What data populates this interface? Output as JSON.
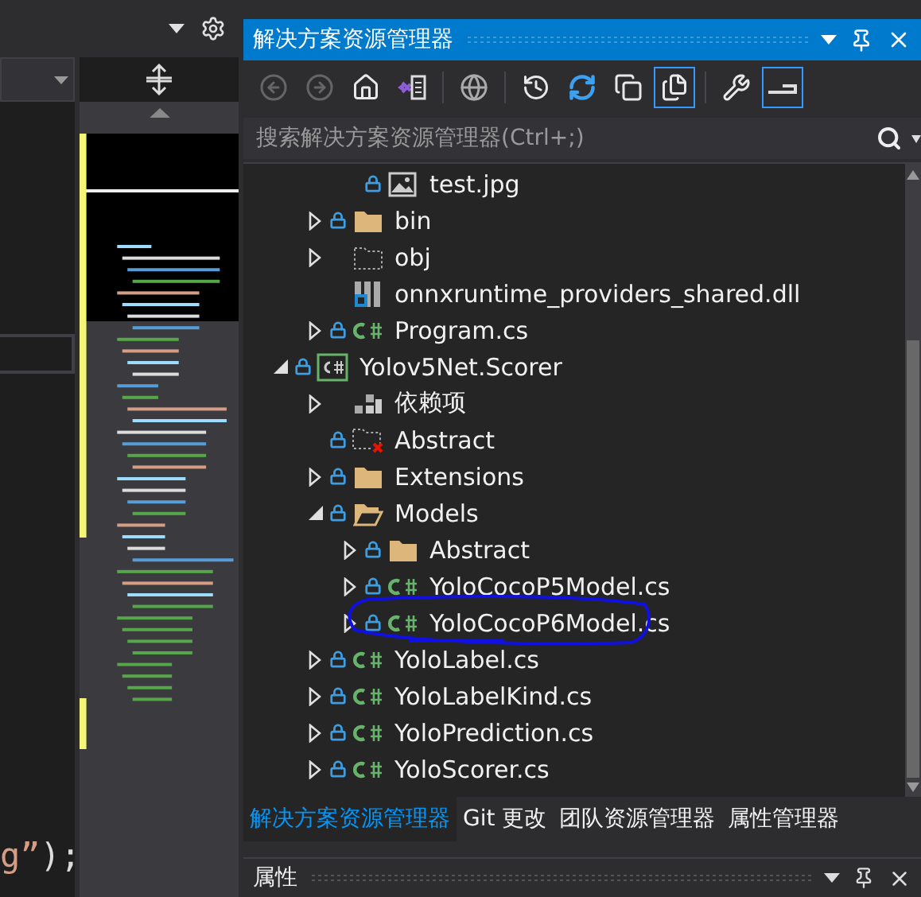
{
  "editor": {
    "code_fragment": [
      {
        "text": "g”",
        "kind": "string"
      },
      {
        "text": ");",
        "kind": "plain"
      }
    ]
  },
  "panel": {
    "title": "解决方案资源管理器"
  },
  "toolbar": [
    {
      "kind": "back",
      "disabled": true,
      "on": false
    },
    {
      "kind": "forward",
      "disabled": true,
      "on": false
    },
    {
      "kind": "home",
      "disabled": false,
      "on": false
    },
    {
      "kind": "vs-switch",
      "disabled": false,
      "on": false
    },
    {
      "kind": "sep"
    },
    {
      "kind": "globe",
      "disabled": false,
      "on": false
    },
    {
      "kind": "sep"
    },
    {
      "kind": "history",
      "disabled": false,
      "on": false
    },
    {
      "kind": "sync",
      "disabled": false,
      "on": false
    },
    {
      "kind": "collapse",
      "disabled": false,
      "on": false
    },
    {
      "kind": "show-all",
      "disabled": false,
      "on": true
    },
    {
      "kind": "sep"
    },
    {
      "kind": "properties",
      "disabled": false,
      "on": false
    },
    {
      "kind": "preview",
      "disabled": false,
      "on": true
    }
  ],
  "search": {
    "placeholder": "搜索解决方案资源管理器(Ctrl+;)"
  },
  "tree_continued": [
    {
      "children": [
        {
          "label": "test.jpg",
          "kind": "image",
          "locked": true
        }
      ]
    },
    {
      "label": "bin",
      "kind": "folder",
      "locked": true,
      "expanded": false
    },
    {
      "label": "obj",
      "kind": "folder-dashed",
      "locked": false,
      "expanded": false
    },
    {
      "label": "onnxruntime_providers_shared.dll",
      "kind": "dll",
      "locked": false
    },
    {
      "label": "Program.cs",
      "kind": "cs",
      "locked": true,
      "expanded": false
    }
  ],
  "tree": [
    {
      "label": "Yolov5Net.Scorer",
      "kind": "project",
      "locked": true,
      "expanded": true,
      "children": [
        {
          "label": "依赖项",
          "kind": "deps",
          "locked": false,
          "expanded": false
        },
        {
          "label": "Abstract",
          "kind": "folder-missing",
          "locked": true
        },
        {
          "label": "Extensions",
          "kind": "folder",
          "locked": true,
          "expanded": false
        },
        {
          "label": "Models",
          "kind": "folder-open",
          "locked": true,
          "expanded": true,
          "children": [
            {
              "label": "Abstract",
              "kind": "folder",
              "locked": true,
              "expanded": false
            },
            {
              "label": "YoloCocoP5Model.cs",
              "kind": "cs",
              "locked": true,
              "expanded": false
            },
            {
              "label": "YoloCocoP6Model.cs",
              "kind": "cs",
              "locked": true,
              "expanded": false,
              "circled": true
            }
          ]
        },
        {
          "label": "YoloLabel.cs",
          "kind": "cs",
          "locked": true,
          "expanded": false
        },
        {
          "label": "YoloLabelKind.cs",
          "kind": "cs",
          "locked": true,
          "expanded": false
        },
        {
          "label": "YoloPrediction.cs",
          "kind": "cs",
          "locked": true,
          "expanded": false
        },
        {
          "label": "YoloScorer.cs",
          "kind": "cs",
          "locked": true,
          "expanded": false
        }
      ]
    }
  ],
  "tabs": [
    {
      "label": "解决方案资源管理器",
      "selected": true
    },
    {
      "label": "Git 更改",
      "selected": false
    },
    {
      "label": "团队资源管理器",
      "selected": false
    },
    {
      "label": "属性管理器",
      "selected": false
    }
  ],
  "properties_panel": {
    "title": "属性"
  }
}
